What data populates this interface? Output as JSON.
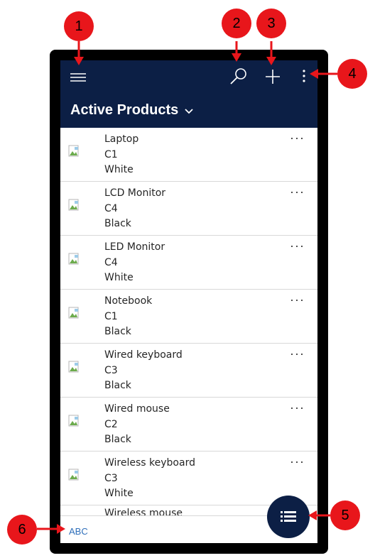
{
  "header": {
    "title": "Active Products",
    "icons": [
      "hamburger-menu-icon",
      "search-icon",
      "plus-icon",
      "more-vertical-icon"
    ]
  },
  "colors": {
    "header_bg": "#0c1f45",
    "callout": "#e8161b",
    "link": "#2f6fba"
  },
  "products": [
    {
      "name": "Laptop",
      "code": "C1",
      "color": "White"
    },
    {
      "name": "LCD Monitor",
      "code": "C4",
      "color": "Black"
    },
    {
      "name": "LED Monitor",
      "code": "C4",
      "color": "White"
    },
    {
      "name": "Notebook",
      "code": "C1",
      "color": "Black"
    },
    {
      "name": "Wired keyboard",
      "code": "C3",
      "color": "Black"
    },
    {
      "name": "Wired mouse",
      "code": "C2",
      "color": "Black"
    },
    {
      "name": "Wireless keyboard",
      "code": "C3",
      "color": "White"
    }
  ],
  "partial_item": "Wireless mouse",
  "row_more_label": "···",
  "footer": {
    "jump_label": "ABC"
  },
  "callouts": [
    "1",
    "2",
    "3",
    "4",
    "5",
    "6"
  ]
}
